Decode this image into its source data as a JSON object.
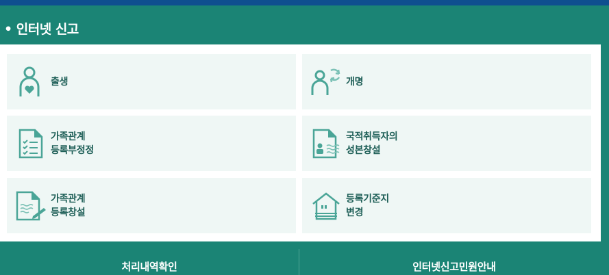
{
  "header": {
    "title": "• 인터넷 신고"
  },
  "tiles": [
    {
      "label": "출생",
      "icon": "birth-person-icon"
    },
    {
      "label": "개명",
      "icon": "rename-person-icon"
    },
    {
      "label": "가족관계\n등록부정정",
      "icon": "checklist-document-icon"
    },
    {
      "label": "국적취득자의\n성본창설",
      "icon": "person-document-icon"
    },
    {
      "label": "가족관계\n등록창설",
      "icon": "document-pen-icon"
    },
    {
      "label": "등록기준지\n변경",
      "icon": "house-icon"
    }
  ],
  "bottom_tabs": [
    {
      "label": "처리내역확인"
    },
    {
      "label": "인터넷신고민원안내"
    }
  ],
  "colors": {
    "accent_green": "#1b8475",
    "tile_bg": "#eff7f5",
    "icon_teal": "#4aa597",
    "top_bar_blue": "#0f4f8f"
  }
}
